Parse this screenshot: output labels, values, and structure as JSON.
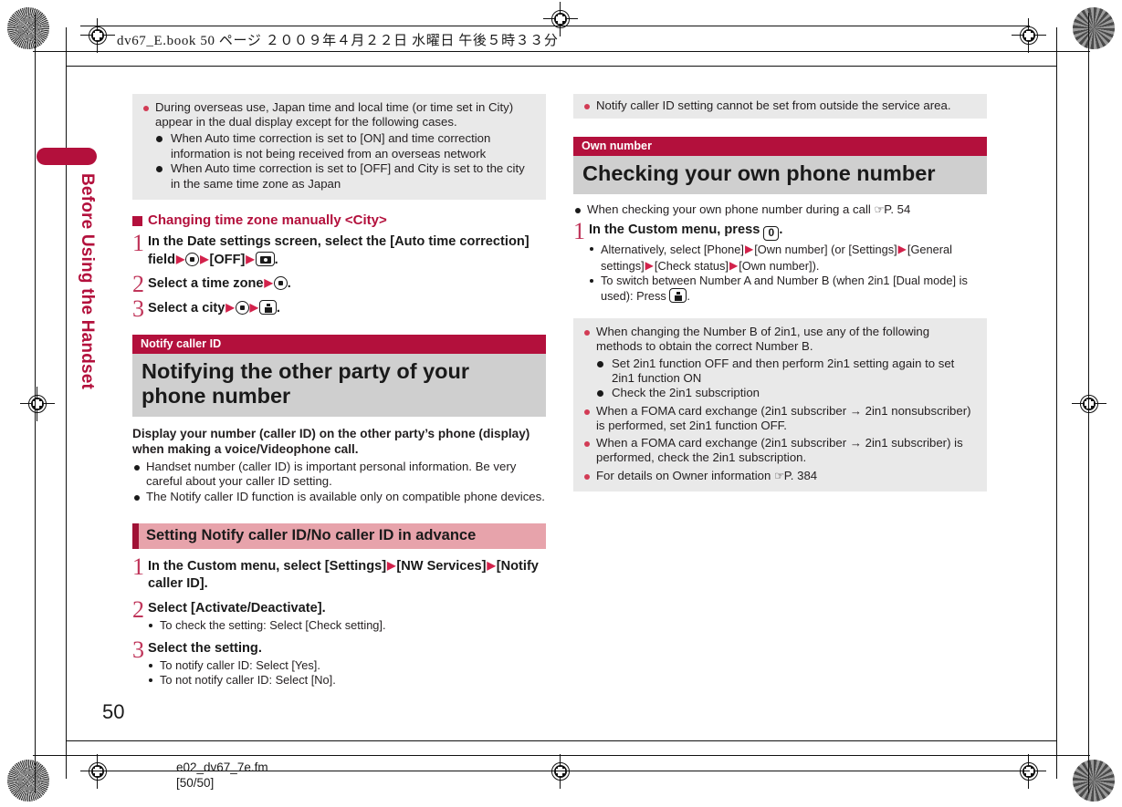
{
  "printer_slug": {
    "text": "dv67_E.book 50 ページ ２００９年４月２２日 水曜日 午後５時３３分"
  },
  "side_tab": {
    "label": "Before Using the Handset"
  },
  "footer": {
    "page_number": "50",
    "file_name": "e02_dv67_7e.fm",
    "file_pages": "[50/50]"
  },
  "colors": {
    "crimson": "#b3103c",
    "pink_bar": "#e7a3ab",
    "pink_bar_edge": "#a01236",
    "note_bg": "#e9e9e9",
    "title_bg": "#cfcfcf",
    "bullet_red": "#d23b55",
    "step_number": "#c0355a"
  },
  "left_column": {
    "note_box_top": {
      "bullets": [
        {
          "text": "During overseas use, Japan time and local time (or time set in City) appear in the dual display except for the following cases.",
          "sub_items": [
            "When Auto time correction is set to [ON] and time correction information is not being received from an overseas network",
            "When Auto time correction is set to [OFF] and City is set to the city in the same time zone as Japan"
          ]
        }
      ]
    },
    "subheading": "Changing time zone manually <City>",
    "steps": [
      {
        "number": "1",
        "text_parts": [
          "In the Date settings screen, select the [Auto time correction] field",
          "[OFF]",
          "."
        ],
        "keys": [
          "select-key",
          "camera-key"
        ]
      },
      {
        "number": "2",
        "text_parts": [
          "Select a time zone",
          "."
        ],
        "keys": [
          "select-key"
        ]
      },
      {
        "number": "3",
        "text_parts": [
          "Select a city",
          "."
        ],
        "keys": [
          "select-key",
          "info-key"
        ]
      }
    ],
    "section": {
      "kicker": "Notify caller ID",
      "title": "Notifying the other party of your phone number"
    },
    "lead": "Display your number (caller ID) on the other party’s phone (display) when making a voice/Videophone call.",
    "lead_bullets": [
      "Handset number (caller ID) is important personal information. Be very careful about your caller ID setting.",
      "The Notify caller ID function is available only on compatible phone devices."
    ],
    "pink_bar": "Setting Notify caller ID/No caller ID in advance",
    "pink_steps": [
      {
        "number": "1",
        "text": "In the Custom menu, select [Settings]▶[NW Services]▶[Notify caller ID].",
        "subs": []
      },
      {
        "number": "2",
        "text": "Select [Activate/Deactivate].",
        "subs": [
          "To check the setting: Select [Check setting]."
        ]
      },
      {
        "number": "3",
        "text": "Select the setting.",
        "subs": [
          "To notify caller ID: Select [Yes].",
          "To not notify caller ID: Select [No]."
        ]
      }
    ]
  },
  "right_column": {
    "note_box_top": {
      "bullets": [
        "Notify caller ID setting cannot be set from outside the service area."
      ]
    },
    "section": {
      "kicker": "Own number",
      "title": "Checking your own phone number"
    },
    "ref_bullet": {
      "text": "When checking your own phone number during a call",
      "ref": "P. 54"
    },
    "step": {
      "number": "1",
      "text_before": "In the Custom menu, press",
      "key_label": "0",
      "text_after": ".",
      "subs": [
        "Alternatively, select [Phone]▶[Own number] (or [Settings]▶[General settings]▶[Check status]▶[Own number]).",
        "To switch between Number A and Number B (when 2in1 [Dual mode] is used): Press"
      ]
    },
    "note_box_bottom": {
      "bullets": [
        {
          "text": "When changing the Number B of 2in1, use any of the following methods to obtain the correct Number B.",
          "sub_items": [
            "Set 2in1 function OFF and then perform 2in1 setting again to set 2in1 function ON",
            "Check the 2in1 subscription"
          ]
        },
        {
          "text": "When a FOMA card exchange (2in1 subscriber → 2in1 nonsubscriber) is performed, set 2in1 function OFF.",
          "sub_items": []
        },
        {
          "text": "When a FOMA card exchange (2in1 subscriber → 2in1 subscriber) is performed, check the 2in1 subscription.",
          "sub_items": []
        },
        {
          "text": "For details on Owner information",
          "ref": "P. 384",
          "sub_items": []
        }
      ]
    }
  }
}
